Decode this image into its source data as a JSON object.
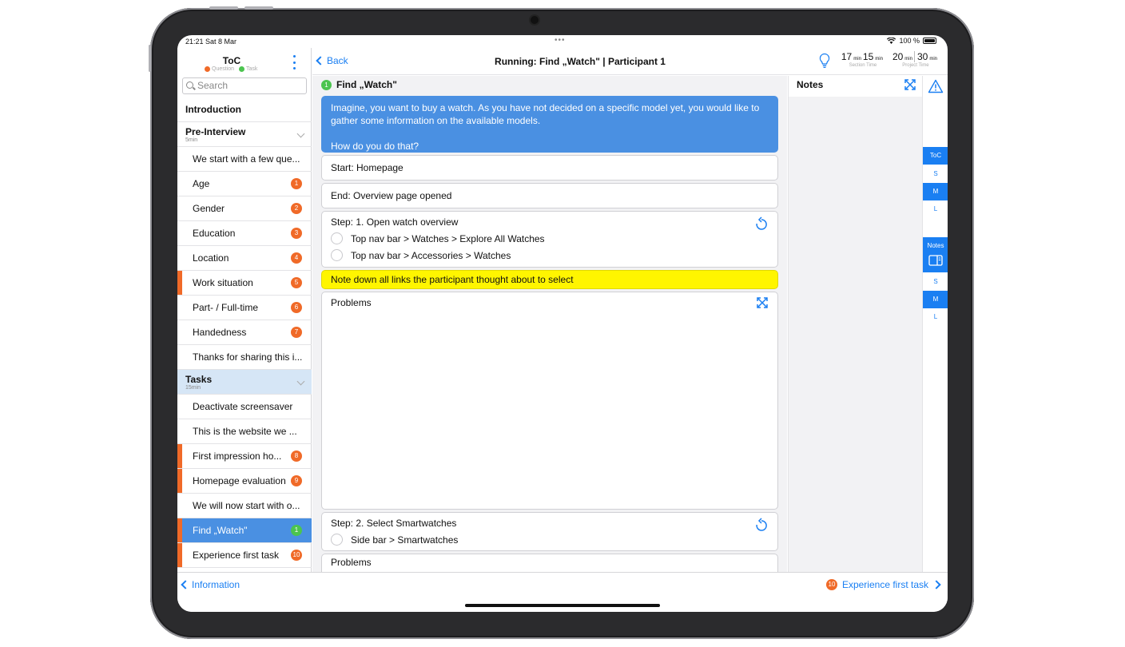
{
  "status": {
    "time": "21:21  Sat 8 Mar",
    "battery": "100 %",
    "dots": "•••"
  },
  "sidebar": {
    "title": "ToC",
    "legend": [
      {
        "label": "Question",
        "color": "#f06a28"
      },
      {
        "label": "Task",
        "color": "#4cc44f"
      }
    ],
    "search_placeholder": "Search",
    "sections": [
      {
        "title": "Introduction"
      },
      {
        "title": "Pre-Interview",
        "duration": "5min"
      },
      {
        "title": "Tasks",
        "duration": "15min"
      }
    ],
    "pre_items": [
      {
        "label": "We start with a few que..."
      },
      {
        "label": "Age",
        "badge": "1"
      },
      {
        "label": "Gender",
        "badge": "2"
      },
      {
        "label": "Education",
        "badge": "3"
      },
      {
        "label": "Location",
        "badge": "4"
      },
      {
        "label": "Work situation",
        "badge": "5"
      },
      {
        "label": "Part- / Full-time",
        "badge": "6"
      },
      {
        "label": "Handedness",
        "badge": "7"
      },
      {
        "label": "Thanks for sharing this i..."
      }
    ],
    "task_items": [
      {
        "label": "Deactivate screensaver"
      },
      {
        "label": "This is the website we ..."
      },
      {
        "label": "First impression ho...",
        "badge": "8"
      },
      {
        "label": "Homepage evaluation",
        "badge": "9"
      },
      {
        "label": "We will now start with o..."
      },
      {
        "label": "Find „Watch\"",
        "badge": "1"
      },
      {
        "label": "Experience first task",
        "badge": "10"
      }
    ]
  },
  "navbar": {
    "back_label": "Back",
    "title": "Running: Find „Watch\" | Participant 1",
    "timer_section": {
      "min": "17",
      "sec": "15",
      "min_unit": "min",
      "sec_unit": "min",
      "label": "Section Time"
    },
    "timer_project": {
      "min": "20",
      "sec": "30",
      "min_unit": "min",
      "sec_unit": "min",
      "label": "Project Time"
    }
  },
  "task": {
    "number": "1",
    "title": "Find „Watch\"",
    "scenario_line1": "Imagine, you want to buy a watch. As you have not decided on a specific model yet, you would like to",
    "scenario_line2": "gather some information on the available models.",
    "scenario_question": "How do you do that?",
    "start": "Start: Homepage",
    "end": "End: Overview page opened",
    "step1_title": "Step: 1. Open watch overview",
    "step1_options": [
      "Top nav bar > Watches > Explore All Watches",
      "Top nav bar > Accessories > Watches"
    ],
    "note": "Note down all links the participant thought about to select",
    "problems1": "Problems",
    "step2_title": "Step: 2. Select Smartwatches",
    "step2_options": [
      "Side bar > Smartwatches"
    ],
    "problems2": "Problems"
  },
  "notes": {
    "title": "Notes"
  },
  "rail": {
    "toc": "ToC",
    "notes": "Notes",
    "sizes": [
      "S",
      "M",
      "L"
    ]
  },
  "bottom": {
    "prev_label": "Information",
    "next_label": "Experience first task",
    "next_badge": "10"
  },
  "colors": {
    "accent": "#1a7ff2",
    "question": "#f06a28",
    "task": "#4cc44f",
    "scenario": "#4a90e2",
    "highlight": "#fff500"
  }
}
